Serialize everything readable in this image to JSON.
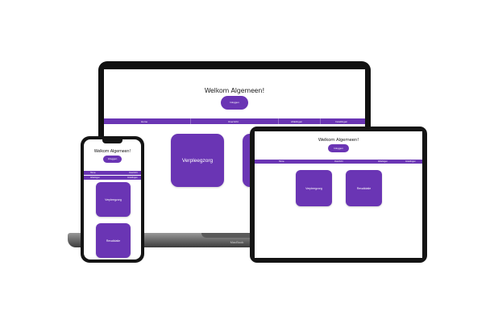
{
  "laptop": {
    "heading": "Welkom Algemeen!",
    "button": "Inloggen",
    "nav": [
      "Home",
      "Overzicht",
      "Afdelingen",
      "Instellingen"
    ],
    "tiles": [
      "Verpleegzorg"
    ],
    "brand": "MacBook"
  },
  "tablet": {
    "heading": "Welkom Algemeen!",
    "button": "Inloggen",
    "nav": [
      "Home",
      "Overzicht",
      "Afdelingen",
      "Instellingen"
    ],
    "tiles": [
      "Verpleegzorg",
      "Revalidatie"
    ]
  },
  "phone": {
    "heading": "Welkom Algemeen!",
    "button": "Inloggen",
    "nav_row1": [
      "Home",
      "Overzicht"
    ],
    "nav_row2": [
      "Afdelingen",
      "Instellingen"
    ],
    "tiles": [
      "Verpleegzorg",
      "Revalidatie"
    ]
  },
  "colors": {
    "accent": "#6a35b4",
    "device_frame": "#141414"
  }
}
